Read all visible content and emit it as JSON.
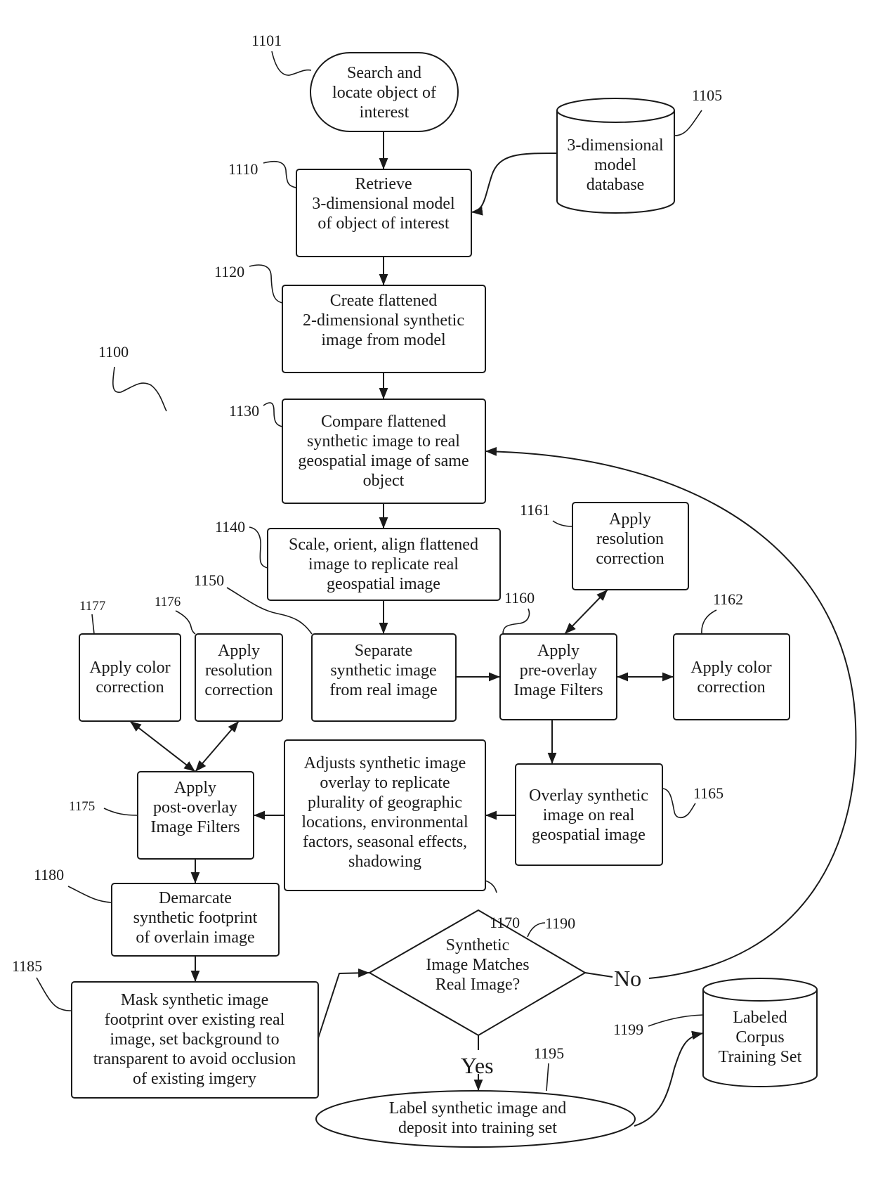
{
  "figure": {
    "reference": "1100",
    "nodes": {
      "n1101": {
        "ref": "1101",
        "shape": "terminator",
        "lines": [
          "Search and",
          "locate object of",
          "interest"
        ]
      },
      "n1105": {
        "ref": "1105",
        "shape": "database",
        "lines": [
          "3-dimensional",
          "model",
          "database"
        ]
      },
      "n1110": {
        "ref": "1110",
        "shape": "process",
        "lines": [
          "Retrieve",
          "3-dimensional model",
          "of object of interest"
        ]
      },
      "n1120": {
        "ref": "1120",
        "shape": "process",
        "lines": [
          "Create flattened",
          "2-dimensional synthetic",
          "image from model"
        ]
      },
      "n1130": {
        "ref": "1130",
        "shape": "process",
        "lines": [
          "Compare flattened",
          "synthetic image to real",
          "geospatial image of same",
          "object"
        ]
      },
      "n1140": {
        "ref": "1140",
        "shape": "process",
        "lines": [
          "Scale, orient, align flattened",
          "image to replicate real",
          "geospatial image"
        ]
      },
      "n1150": {
        "ref": "1150",
        "shape": "process",
        "lines": [
          "Separate",
          "synthetic image",
          "from real image"
        ]
      },
      "n1160": {
        "ref": "1160",
        "shape": "process",
        "lines": [
          "Apply",
          "pre-overlay",
          "Image Filters"
        ]
      },
      "n1161": {
        "ref": "1161",
        "shape": "process",
        "lines": [
          "Apply",
          "resolution",
          "correction"
        ]
      },
      "n1162": {
        "ref": "1162",
        "shape": "process",
        "lines": [
          "Apply color",
          "correction"
        ]
      },
      "n1165": {
        "ref": "1165",
        "shape": "process",
        "lines": [
          "Overlay synthetic",
          "image on real",
          "geospatial image"
        ]
      },
      "n1170": {
        "ref": "1170",
        "shape": "process",
        "lines": [
          "Adjusts synthetic image",
          "overlay to replicate",
          "plurality of geographic",
          "locations, environmental",
          "factors, seasonal effects,",
          "shadowing"
        ]
      },
      "n1175": {
        "ref": "1175",
        "shape": "process",
        "lines": [
          "Apply",
          "post-overlay",
          "Image Filters"
        ]
      },
      "n1176": {
        "ref": "1176",
        "shape": "process",
        "lines": [
          "Apply",
          "resolution",
          "correction"
        ]
      },
      "n1177": {
        "ref": "1177",
        "shape": "process",
        "lines": [
          "Apply color",
          "correction"
        ]
      },
      "n1180": {
        "ref": "1180",
        "shape": "process",
        "lines": [
          "Demarcate",
          "synthetic footprint",
          "of overlain image"
        ]
      },
      "n1185": {
        "ref": "1185",
        "shape": "process",
        "lines": [
          "Mask synthetic image",
          "footprint over existing real",
          "image, set background to",
          "transparent to avoid occlusion",
          "of existing imgery"
        ]
      },
      "n1190": {
        "ref": "1190",
        "shape": "decision",
        "lines": [
          "Synthetic",
          "Image  Matches",
          "Real Image?"
        ]
      },
      "n1195": {
        "ref": "1195",
        "shape": "terminator",
        "lines": [
          "Label synthetic image and",
          "deposit into training set"
        ]
      },
      "n1199": {
        "ref": "1199",
        "shape": "database",
        "lines": [
          "Labeled",
          "Corpus",
          "Training Set"
        ]
      }
    },
    "branch_labels": {
      "no": "No",
      "yes": "Yes"
    },
    "edges": [
      {
        "from": "1101",
        "to": "1110"
      },
      {
        "from": "1105",
        "to": "1110"
      },
      {
        "from": "1110",
        "to": "1120"
      },
      {
        "from": "1120",
        "to": "1130"
      },
      {
        "from": "1130",
        "to": "1140"
      },
      {
        "from": "1140",
        "to": "1150"
      },
      {
        "from": "1150",
        "to": "1160"
      },
      {
        "from": "1160",
        "to": "1161",
        "bidirectional": true
      },
      {
        "from": "1160",
        "to": "1162",
        "bidirectional": true
      },
      {
        "from": "1160",
        "to": "1165"
      },
      {
        "from": "1165",
        "to": "1170"
      },
      {
        "from": "1170",
        "to": "1175"
      },
      {
        "from": "1175",
        "to": "1177",
        "bidirectional": true
      },
      {
        "from": "1175",
        "to": "1176",
        "bidirectional": true
      },
      {
        "from": "1175",
        "to": "1180"
      },
      {
        "from": "1180",
        "to": "1185"
      },
      {
        "from": "1185",
        "to": "1190"
      },
      {
        "from": "1190",
        "to": "1130",
        "label": "No"
      },
      {
        "from": "1190",
        "to": "1195",
        "label": "Yes"
      },
      {
        "from": "1195",
        "to": "1199"
      }
    ]
  }
}
